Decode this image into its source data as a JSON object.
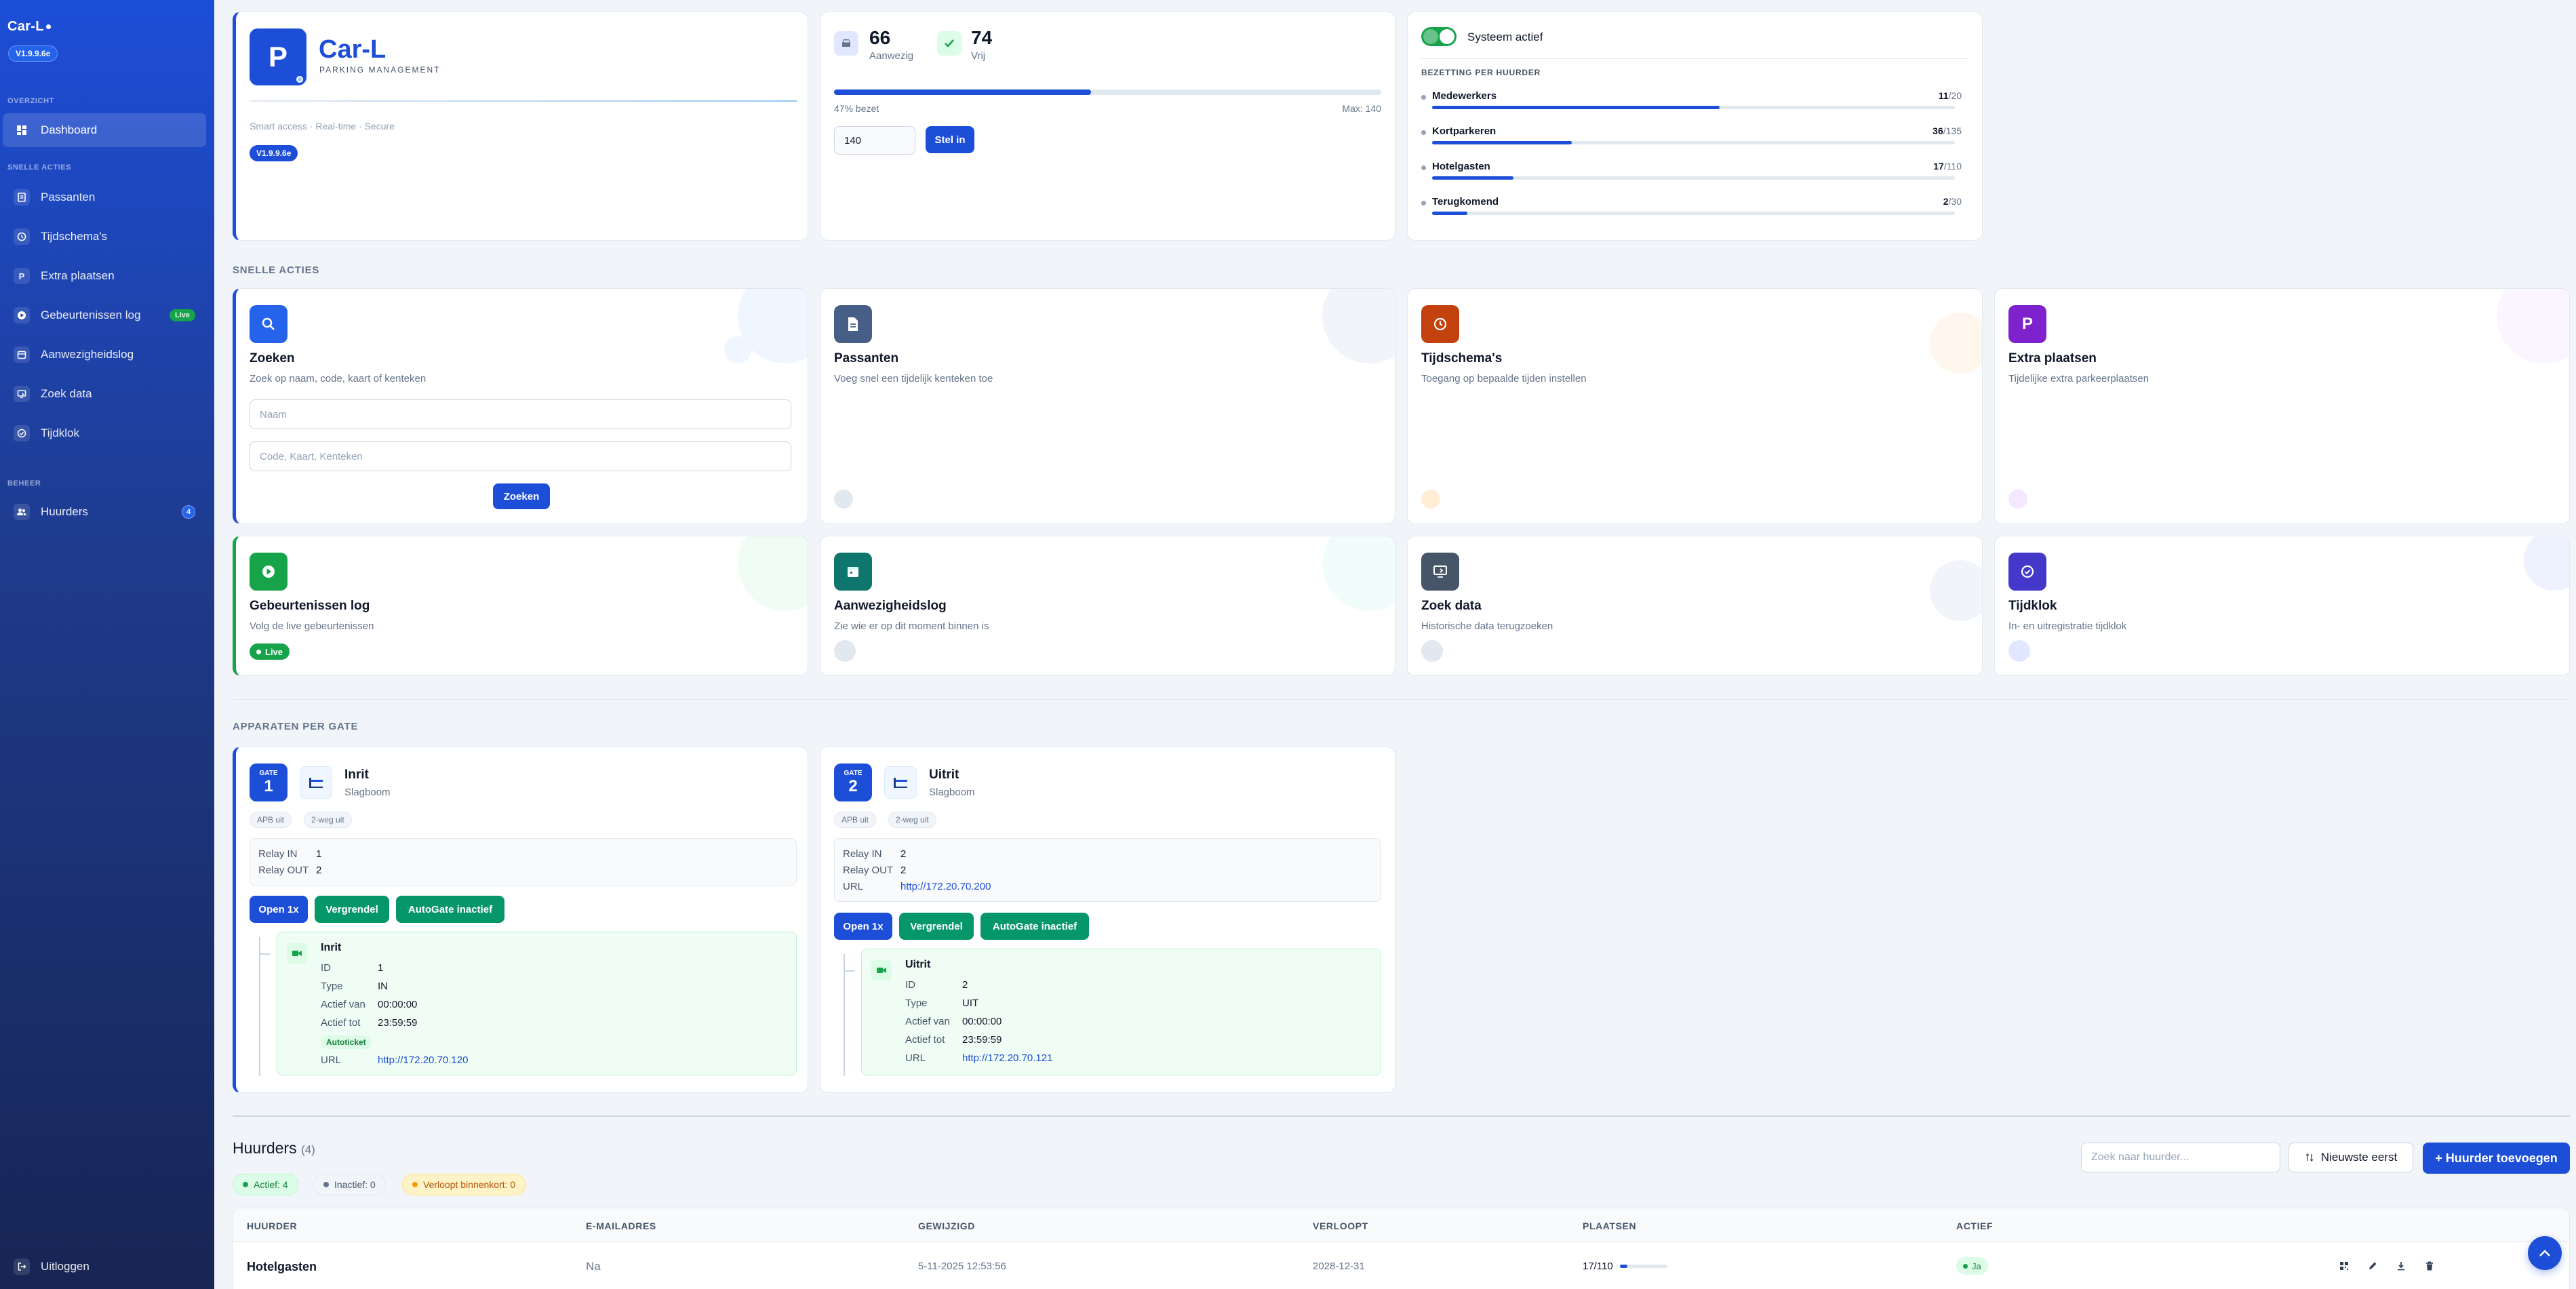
{
  "sidebar": {
    "brand": "Car-L",
    "version": "V1.9.9.6e",
    "sections": {
      "overview": "OVERZICHT",
      "quick": "SNELLE ACTIES",
      "manage": "BEHEER"
    },
    "items": [
      {
        "label": "Dashboard",
        "icon": "dashboard-icon"
      },
      {
        "label": "Passanten",
        "icon": "document-icon"
      },
      {
        "label": "Tijdschema's",
        "icon": "clock-icon"
      },
      {
        "label": "Extra plaatsen",
        "icon": "parking-icon"
      },
      {
        "label": "Gebeurtenissen log",
        "icon": "play-icon",
        "badge": "Live"
      },
      {
        "label": "Aanwezigheidslog",
        "icon": "calendar-icon"
      },
      {
        "label": "Zoek data",
        "icon": "history-icon"
      },
      {
        "label": "Tijdklok",
        "icon": "check-clock-icon"
      },
      {
        "label": "Huurders",
        "icon": "users-icon",
        "count": "4"
      }
    ],
    "logout": "Uitloggen"
  },
  "header": {
    "logo_letter": "P",
    "title": "Car-L",
    "subtitle": "PARKING MANAGEMENT",
    "tagline": "Smart access · Real-time · Secure",
    "version": "V1.9.9.6e"
  },
  "occupancy": {
    "present_value": "66",
    "present_label": "Aanwezig",
    "free_value": "74",
    "free_label": "Vrij",
    "percent_text": "47% bezet",
    "percent": 47,
    "max_text": "Max: 140",
    "capacity_input": "140",
    "set_button": "Stel in"
  },
  "system": {
    "toggle_label": "Systeem actief",
    "toggle_on": true,
    "section_title": "BEZETTING PER HUURDER",
    "tenants": [
      {
        "name": "Medewerkers",
        "used": "11",
        "total": "/20",
        "ratio": 0.55
      },
      {
        "name": "Kortparkeren",
        "used": "36",
        "total": "/135",
        "ratio": 0.267
      },
      {
        "name": "Hotelgasten",
        "used": "17",
        "total": "/110",
        "ratio": 0.155
      },
      {
        "name": "Terugkomend",
        "used": "2",
        "total": "/30",
        "ratio": 0.067
      }
    ]
  },
  "quick_actions": {
    "title": "SNELLE ACTIES",
    "search": {
      "title": "Zoeken",
      "subtitle": "Zoek op naam, code, kaart of kenteken",
      "name_placeholder": "Naam",
      "code_placeholder": "Code, Kaart, Kenteken",
      "button": "Zoeken"
    },
    "cards": [
      {
        "title": "Passanten",
        "subtitle": "Voeg snel een tijdelijk kenteken toe",
        "color": "#475f86"
      },
      {
        "title": "Tijdschema's",
        "subtitle": "Toegang op bepaalde tijden instellen",
        "color": "#c2410c"
      },
      {
        "title": "Extra plaatsen",
        "subtitle": "Tijdelijke extra parkeerplaatsen",
        "color": "#7e22ce"
      },
      {
        "title": "Gebeurtenissen log",
        "subtitle": "Volg de live gebeurtenissen",
        "color": "#16a34a",
        "badge": "Live"
      },
      {
        "title": "Aanwezigheidslog",
        "subtitle": "Zie wie er op dit moment binnen is",
        "color": "#0f766e"
      },
      {
        "title": "Zoek data",
        "subtitle": "Historische data terugzoeken",
        "color": "#475569"
      },
      {
        "title": "Tijdklok",
        "subtitle": "In- en uitregistratie tijdklok",
        "color": "#4338ca"
      }
    ]
  },
  "devices": {
    "title": "APPARATEN PER GATE",
    "gates": [
      {
        "gate_label": "GATE",
        "gate_no": "1",
        "name": "Inrit",
        "type": "Slagboom",
        "tags": [
          "APB uit",
          "2-weg uit"
        ],
        "relay_in_label": "Relay IN",
        "relay_in": "1",
        "relay_out_label": "Relay OUT",
        "relay_out": "2",
        "buttons": [
          "Open 1x",
          "Vergrendel",
          "AutoGate inactief"
        ],
        "device": {
          "name": "Inrit",
          "id_label": "ID",
          "id": "1",
          "type_label": "Type",
          "type": "IN",
          "from_label": "Actief van",
          "from": "00:00:00",
          "to_label": "Actief tot",
          "to": "23:59:59",
          "badge": "Autoticket",
          "url_label": "URL",
          "url": "http://172.20.70.120"
        }
      },
      {
        "gate_label": "GATE",
        "gate_no": "2",
        "name": "Uitrit",
        "type": "Slagboom",
        "tags": [
          "APB uit",
          "2-weg uit"
        ],
        "relay_in_label": "Relay IN",
        "relay_in": "2",
        "relay_out_label": "Relay OUT",
        "relay_out": "2",
        "url_label": "URL",
        "url": "http://172.20.70.200",
        "buttons": [
          "Open 1x",
          "Vergrendel",
          "AutoGate inactief"
        ],
        "device": {
          "name": "Uitrit",
          "id_label": "ID",
          "id": "2",
          "type_label": "Type",
          "type": "UIT",
          "from_label": "Actief van",
          "from": "00:00:00",
          "to_label": "Actief tot",
          "to": "23:59:59",
          "url_label": "URL",
          "url": "http://172.20.70.121"
        }
      }
    ]
  },
  "tenants": {
    "title": "Huurders",
    "count": "(4)",
    "filters": {
      "active": "Actief: 4",
      "inactive": "Inactief: 0",
      "expiring": "Verloopt binnenkort: 0"
    },
    "search_placeholder": "Zoek naar huurder...",
    "sort_label": "Nieuwste eerst",
    "add_button": "+ Huurder toevoegen",
    "columns": [
      "HUURDER",
      "E-MAILADRES",
      "GEWIJZIGD",
      "VERLOOPT",
      "PLAATSEN",
      "ACTIEF"
    ],
    "rows": [
      {
        "name": "Hotelgasten",
        "email": "Na",
        "modified": "5-11-2025 12:53:56",
        "expires": "2028-12-31",
        "places": "17/110",
        "ratio": 0.155,
        "active": "Ja"
      }
    ]
  }
}
